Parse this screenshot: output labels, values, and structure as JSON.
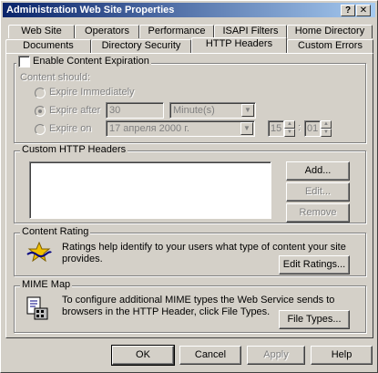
{
  "window": {
    "title": "Administration Web Site Properties",
    "help_glyph": "?",
    "close_glyph": "✕"
  },
  "tabs_row1": [
    "Web Site",
    "Operators",
    "Performance",
    "ISAPI Filters",
    "Home Directory"
  ],
  "tabs_row2": [
    "Documents",
    "Directory Security",
    "HTTP Headers",
    "Custom Errors"
  ],
  "active_tab": "HTTP Headers",
  "content_expiration": {
    "checkbox_label": "Enable Content Expiration",
    "checked": false,
    "content_should_label": "Content should:",
    "option_immediately": "Expire Immediately",
    "option_after": "Expire after",
    "after_value": "30",
    "after_unit": "Minute(s)",
    "option_on": "Expire on",
    "on_date": "17 апреля 2000 г.",
    "on_hour": "15",
    "time_separator": ":",
    "on_minute": "01",
    "selected_option": "after"
  },
  "custom_headers": {
    "label": "Custom HTTP Headers",
    "add_label": "Add...",
    "edit_label": "Edit...",
    "remove_label": "Remove"
  },
  "content_rating": {
    "label": "Content Rating",
    "description": "Ratings help identify to your users what type of content your site provides.",
    "button_label": "Edit Ratings..."
  },
  "mime_map": {
    "label": "MIME Map",
    "description": "To configure additional MIME types the Web Service sends to browsers in the HTTP Header, click File Types.",
    "button_label": "File Types..."
  },
  "footer": {
    "ok": "OK",
    "cancel": "Cancel",
    "apply": "Apply",
    "help": "Help"
  }
}
